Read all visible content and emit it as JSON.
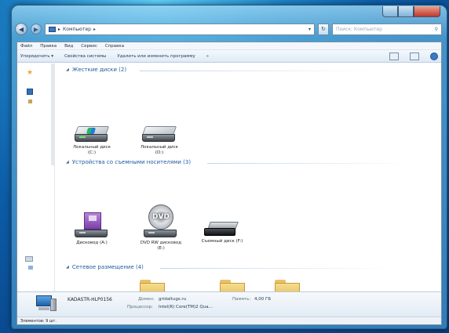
{
  "window": {
    "address": "Компьютер",
    "search_placeholder": "Поиск: Компьютер"
  },
  "menu": [
    "Файл",
    "Правка",
    "Вид",
    "Сервис",
    "Справка"
  ],
  "toolbar": {
    "organize": "Упорядочить ▾",
    "system_props": "Свойства системы",
    "uninstall": "Удалить или изменить программу",
    "more": "»"
  },
  "groups": {
    "hdd": "Жесткие диски (2)",
    "removable": "Устройства со съемными носителями (3)",
    "network": "Сетевое размещение (4)"
  },
  "items": {
    "c_drive": "Локальный диск (C:)",
    "d_drive": "Локальный диск (D:)",
    "floppy": "Дисковод (A:)",
    "dvd": "DVD RW дисковод (E:)",
    "removable": "Съемный диск (F:)",
    "dvd_label": "DVD"
  },
  "details": {
    "computer_name": "KADASTR-HLP0156",
    "domain_label": "Домен:",
    "domain_value": "gridaltugs.ru",
    "memory_label": "Память:",
    "memory_value": "4,00 ГБ",
    "cpu_label": "Процессор:",
    "cpu_value": "Intel(R) Core(TM)2 Qua..."
  },
  "status": "Элементов: 9 шт."
}
